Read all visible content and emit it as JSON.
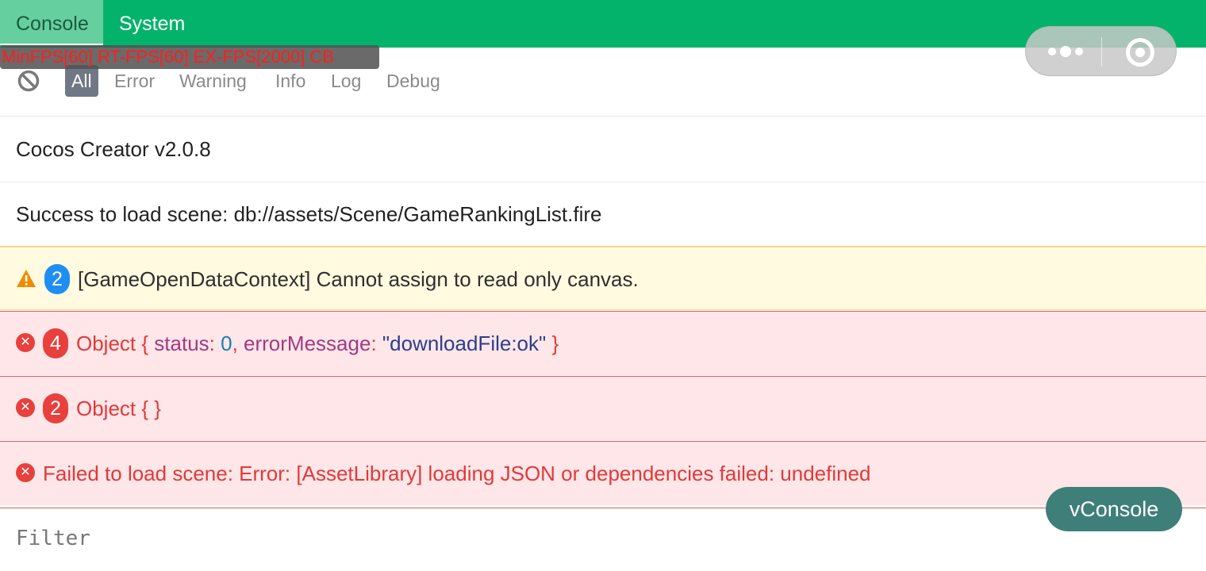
{
  "tabs": [
    {
      "label": "Console",
      "active": true
    },
    {
      "label": "System",
      "active": false
    }
  ],
  "fps_overlay": "MinFPS[60] RT-FPS[60] EX-FPS[2000] CB",
  "levels": [
    "All",
    "Error",
    "Warning",
    "Info",
    "Log",
    "Debug"
  ],
  "active_level": "All",
  "logs": [
    {
      "type": "log",
      "text": "Cocos Creator v2.0.8"
    },
    {
      "type": "log",
      "text": "Success to load scene: db://assets/Scene/GameRankingList.fire"
    },
    {
      "type": "warn",
      "count": "2",
      "text": "[GameOpenDataContext] Cannot assign to read only canvas."
    },
    {
      "type": "error",
      "count": "4",
      "prefix": "Object { ",
      "key1": "status",
      "colon1": ": ",
      "val1": "0",
      "comma": ", ",
      "key2": "errorMessage",
      "colon2": ": ",
      "val2": "\"downloadFile:ok\"",
      "suffix": " }"
    },
    {
      "type": "error",
      "count": "2",
      "text": "Object {  }"
    },
    {
      "type": "error",
      "text": "Failed to load scene: Error: [AssetLibrary] loading JSON or dependencies failed: undefined"
    }
  ],
  "filter": {
    "placeholder": "Filter",
    "value": ""
  },
  "vconsole_button": "vConsole",
  "colors": {
    "topbar": "#04b36b",
    "warn_bg": "#fffae0",
    "error_bg": "#ffe6e8",
    "error_text": "#e03a3a",
    "badge_blue": "#1e8ef2",
    "badge_red": "#e8403c",
    "vconsole_btn": "#3f7f7a"
  },
  "icons": [
    "clear-icon",
    "more-dots-icon",
    "exit-ring-icon",
    "warning-icon",
    "error-icon"
  ]
}
